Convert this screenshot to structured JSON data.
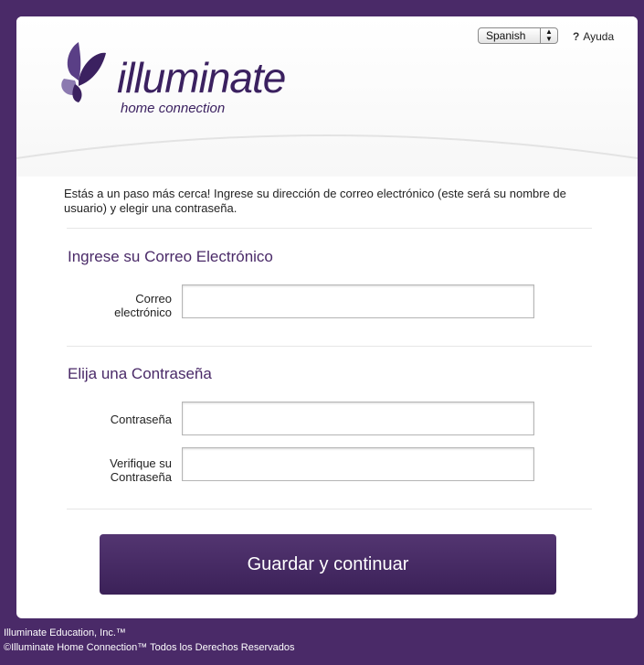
{
  "header": {
    "logo_word": "illuminate",
    "logo_subtitle": "home connection",
    "language_selected": "Spanish",
    "help_icon": "?",
    "help_label": "Ayuda"
  },
  "intro_text": "Estás a un paso más cerca! Ingrese su dirección de correo electrónico (este será su nombre de usuario) y elegir una contraseña.",
  "email_section": {
    "title": "Ingrese su Correo Electrónico",
    "email_label_line1": "Correo",
    "email_label_line2": "electrónico",
    "email_value": ""
  },
  "password_section": {
    "title": "Elija una Contraseña",
    "password_label": "Contraseña",
    "password_value": "",
    "verify_label_line1": "Verifique su",
    "verify_label_line2": "Contraseña",
    "verify_value": ""
  },
  "submit_label": "Guardar y continuar",
  "footer": {
    "line1": "Illuminate Education, Inc.™",
    "line2": "©Illuminate Home Connection™ Todos los Derechos Reservados"
  },
  "colors": {
    "brand_purple": "#4a2a68",
    "button_top": "#533571",
    "button_bottom": "#3b2158"
  },
  "icons": [
    "butterfly-logo-icon",
    "select-arrows-icon",
    "help-icon"
  ]
}
